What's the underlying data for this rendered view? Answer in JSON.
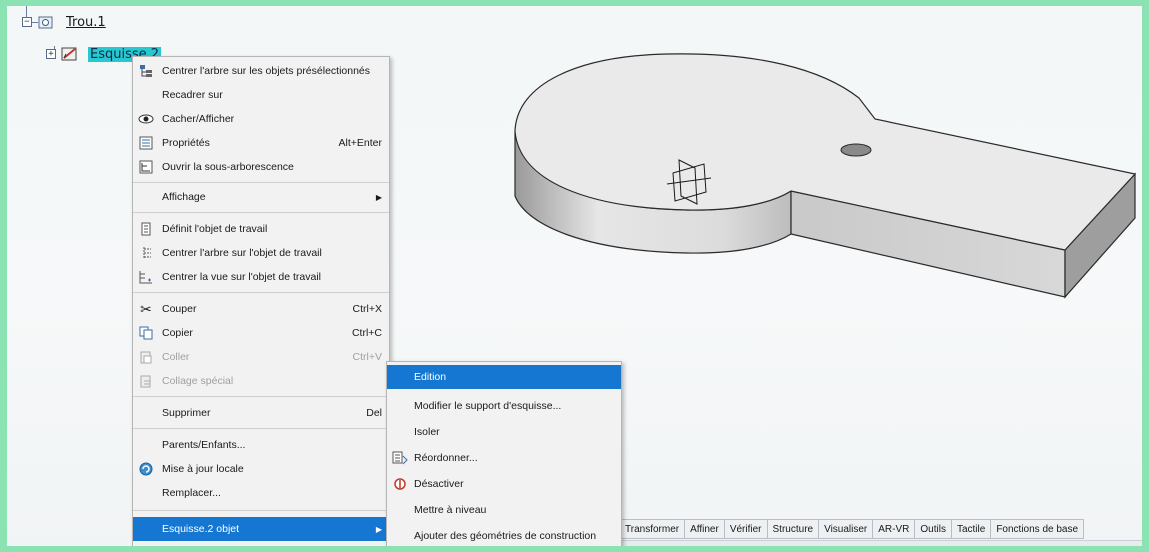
{
  "tree": {
    "node1": {
      "label": "Trou.1",
      "expander": "−"
    },
    "node2": {
      "label": "Esquisse.2",
      "expander": "+"
    }
  },
  "context_menu": {
    "items": [
      {
        "label": "Centrer l'arbre sur les objets présélectionnés",
        "shortcut": "",
        "icon": "center-tree-icon"
      },
      {
        "label": "Recadrer sur",
        "shortcut": "",
        "icon": ""
      },
      {
        "label": "Cacher/Afficher",
        "shortcut": "",
        "icon": "eye-icon"
      },
      {
        "label": "Propriétés",
        "shortcut": "Alt+Enter",
        "icon": "properties-icon"
      },
      {
        "label": "Ouvrir la sous-arborescence",
        "shortcut": "",
        "icon": "subtree-icon"
      },
      {
        "label": "Affichage",
        "shortcut": "",
        "icon": "",
        "submenu": true
      },
      {
        "label": "Définit l'objet de travail",
        "shortcut": "",
        "icon": "define-work-object-icon"
      },
      {
        "label": "Centrer l'arbre sur l'objet de travail",
        "shortcut": "",
        "icon": "center-tree-work-icon"
      },
      {
        "label": "Centrer la vue sur l'objet de travail",
        "shortcut": "",
        "icon": "center-view-work-icon"
      },
      {
        "label": "Couper",
        "shortcut": "Ctrl+X",
        "icon": "scissors-icon"
      },
      {
        "label": "Copier",
        "shortcut": "Ctrl+C",
        "icon": "copy-icon"
      },
      {
        "label": "Coller",
        "shortcut": "Ctrl+V",
        "icon": "paste-icon",
        "disabled": true
      },
      {
        "label": "Collage spécial",
        "shortcut": "",
        "icon": "paste-special-icon",
        "disabled": true
      },
      {
        "label": "Supprimer",
        "shortcut": "Del",
        "icon": ""
      },
      {
        "label": "Parents/Enfants...",
        "shortcut": "",
        "icon": ""
      },
      {
        "label": "Mise à jour locale",
        "shortcut": "",
        "icon": "update-icon"
      },
      {
        "label": "Remplacer...",
        "shortcut": "",
        "icon": ""
      },
      {
        "label": "Esquisse.2 objet",
        "shortcut": "",
        "icon": "",
        "submenu": true,
        "highlighted": true
      }
    ]
  },
  "submenu": {
    "items": [
      {
        "label": "Edition",
        "highlighted": true,
        "icon": ""
      },
      {
        "label": "Modifier le support d'esquisse...",
        "icon": ""
      },
      {
        "label": "Isoler",
        "icon": ""
      },
      {
        "label": "Réordonner...",
        "icon": "reorder-icon"
      },
      {
        "label": "Désactiver",
        "icon": "deactivate-icon"
      },
      {
        "label": "Mettre à niveau",
        "icon": ""
      },
      {
        "label": "Ajouter des géométries de construction",
        "icon": ""
      }
    ]
  },
  "toolbar_tabs": [
    "Transformer",
    "Affiner",
    "Vérifier",
    "Structure",
    "Visualiser",
    "AR-VR",
    "Outils",
    "Tactile",
    "Fonctions de base"
  ],
  "colors": {
    "frame": "#8be3b3",
    "selection": "#27c8cf",
    "highlight": "#1577d2"
  }
}
